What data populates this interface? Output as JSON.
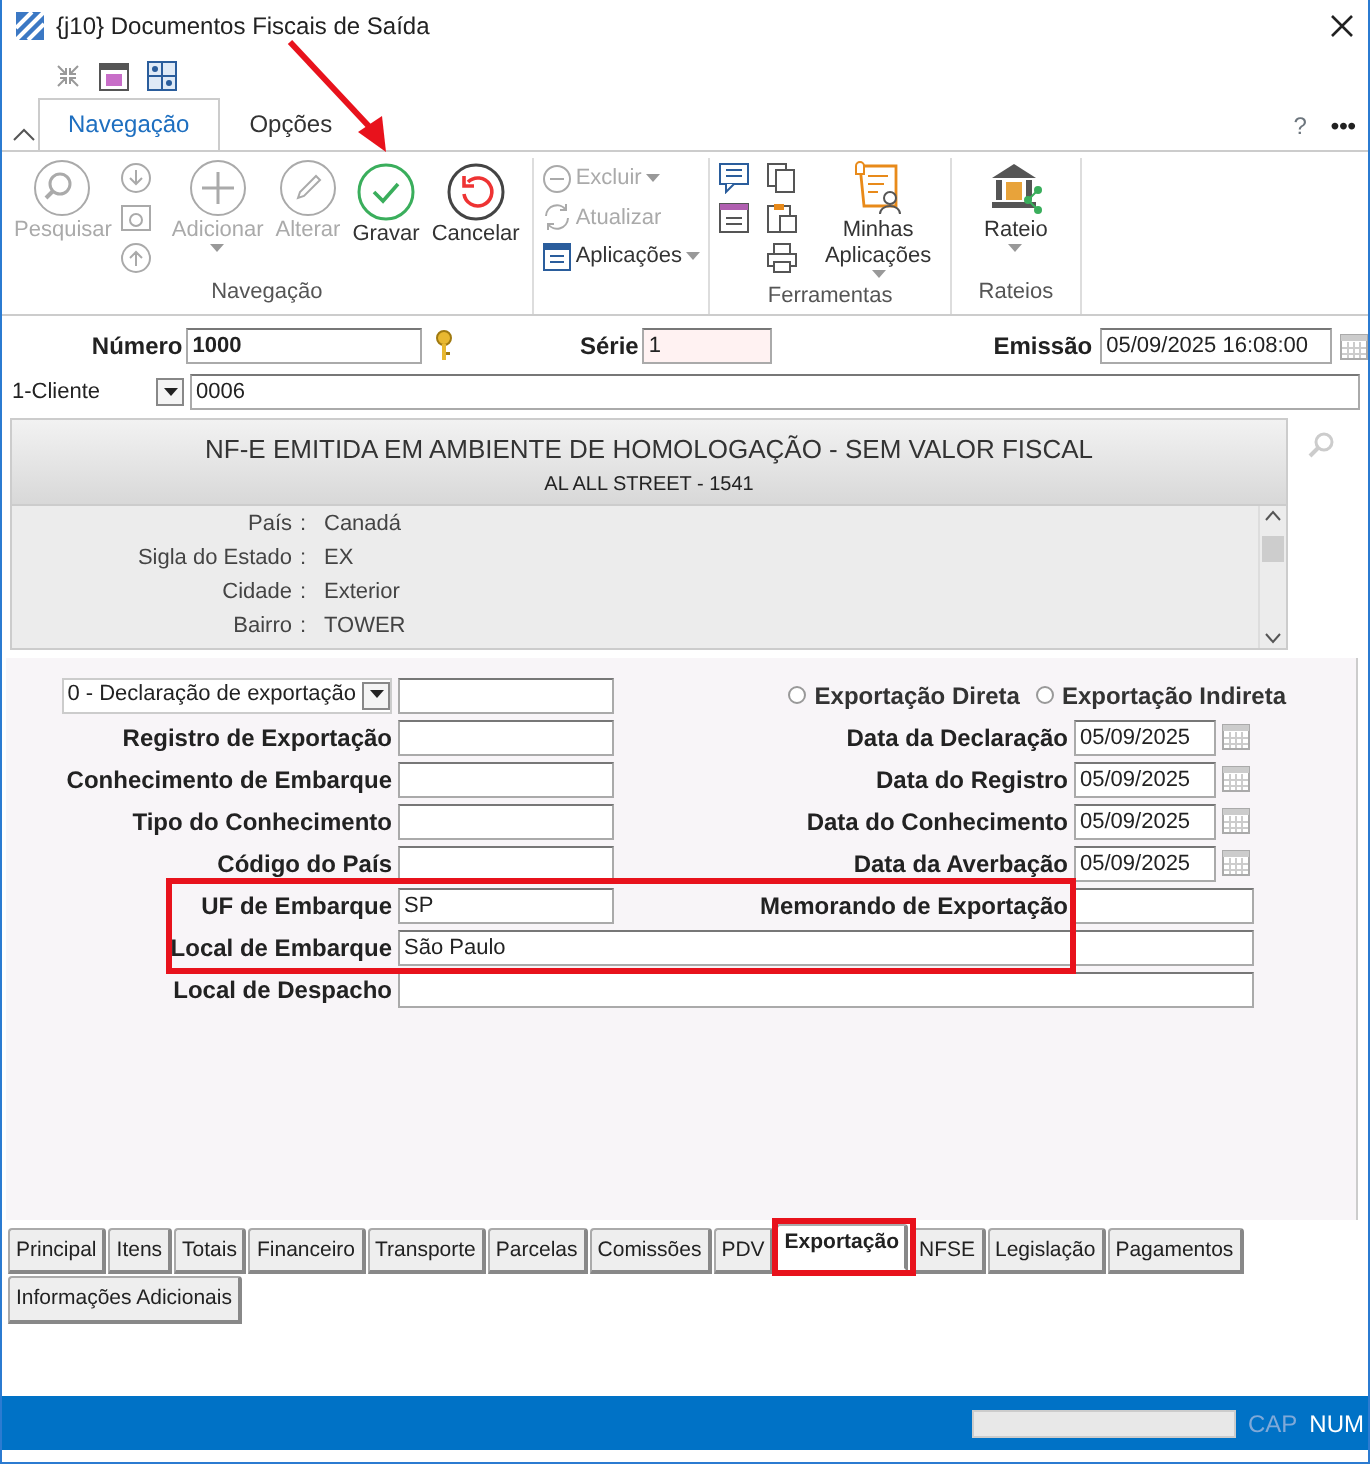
{
  "window": {
    "title": "{j10} Documentos Fiscais de Saída"
  },
  "ribbon": {
    "tabs": [
      {
        "label": "Navegação",
        "selected": true
      },
      {
        "label": "Opções",
        "selected": false
      }
    ],
    "help": "?",
    "more": "•••",
    "navigation": {
      "label": "Navegação",
      "buttons": [
        {
          "kind": "search",
          "label": "Pesquisar",
          "disabled": true,
          "dropdown": false
        },
        {
          "kind": "add",
          "label": "Adicionar",
          "disabled": true,
          "dropdown": true
        },
        {
          "kind": "edit",
          "label": "Alterar",
          "disabled": true,
          "dropdown": false
        },
        {
          "kind": "save",
          "label": "Gravar",
          "disabled": false,
          "dropdown": false
        },
        {
          "kind": "cancel",
          "label": "Cancelar",
          "disabled": false,
          "dropdown": false
        }
      ],
      "menu": [
        {
          "kind": "delete",
          "label": "Excluir",
          "disabled": true,
          "dropdown": true
        },
        {
          "kind": "refresh",
          "label": "Atualizar",
          "disabled": true,
          "dropdown": false
        },
        {
          "kind": "apps",
          "label": "Aplicações",
          "disabled": false,
          "dropdown": true
        }
      ]
    },
    "tools": {
      "label": "Ferramentas",
      "button": {
        "label": "Minhas Aplicações",
        "dropdown": true
      }
    },
    "rateios": {
      "label": "Rateios",
      "button": {
        "label": "Rateio",
        "dropdown": true
      }
    }
  },
  "header": {
    "numero": {
      "label": "Número",
      "value": "1000"
    },
    "serie": {
      "label": "Série",
      "value": "1"
    },
    "emissao": {
      "label": "Emissão",
      "value": "05/09/2025 16:08:00"
    },
    "tipo": {
      "value": "1-Cliente"
    },
    "codigo": {
      "value": "0006"
    }
  },
  "info": {
    "title": "NF-E EMITIDA EM AMBIENTE DE HOMOLOGAÇÃO - SEM VALOR FISCAL",
    "subtitle": "AL ALL STREET - 1541",
    "rows": [
      {
        "label": "País",
        "separator": ":",
        "value": "Canadá"
      },
      {
        "label": "Sigla do Estado",
        "separator": ":",
        "value": "EX"
      },
      {
        "label": "Cidade",
        "separator": ":",
        "value": "Exterior"
      },
      {
        "label": "Bairro",
        "separator": ":",
        "value": "TOWER"
      }
    ]
  },
  "export": {
    "declaration_select": "0 - Declaração de exportação",
    "radios": [
      {
        "label": "Exportação Direta",
        "selected": false
      },
      {
        "label": "Exportação Indireta",
        "selected": false
      }
    ],
    "left_fields": [
      {
        "label": "Registro de Exportação"
      },
      {
        "label": "Conhecimento de Embarque"
      },
      {
        "label": "Tipo do Conhecimento"
      },
      {
        "label": "Código do País"
      }
    ],
    "date_fields": [
      {
        "label": "Data da Declaração",
        "value": "05/09/2025"
      },
      {
        "label": "Data do Registro",
        "value": "05/09/2025"
      },
      {
        "label": "Data do Conhecimento",
        "value": "05/09/2025"
      },
      {
        "label": "Data da Averbação",
        "value": "05/09/2025"
      }
    ],
    "uf_embarque": {
      "label": "UF de Embarque",
      "value": "SP"
    },
    "memorando": {
      "label": "Memorando de Exportação"
    },
    "local_embarque": {
      "label": "Local de Embarque",
      "value": "São Paulo"
    },
    "local_despacho": {
      "label": "Local de Despacho"
    }
  },
  "tab_rows": [
    {
      "tabs": [
        {
          "label": "Principal",
          "selected": false
        },
        {
          "label": "Itens",
          "selected": false
        },
        {
          "label": "Totais",
          "selected": false
        },
        {
          "label": "Financeiro",
          "selected": false
        },
        {
          "label": "Transporte",
          "selected": false
        },
        {
          "label": "Parcelas",
          "selected": false
        },
        {
          "label": "Comissões",
          "selected": false
        },
        {
          "label": "PDV",
          "selected": false
        },
        {
          "label": "Exportação",
          "selected": true
        },
        {
          "label": "NFSE",
          "selected": false
        },
        {
          "label": "Legislação",
          "selected": false
        },
        {
          "label": "Pagamentos",
          "selected": false
        }
      ]
    },
    {
      "tabs": [
        {
          "label": "Informações Adicionais",
          "selected": false
        }
      ]
    }
  ],
  "status_bar": {
    "indicators": [
      {
        "label": "CAP",
        "on": false
      },
      {
        "label": "NUM",
        "on": true
      }
    ]
  }
}
